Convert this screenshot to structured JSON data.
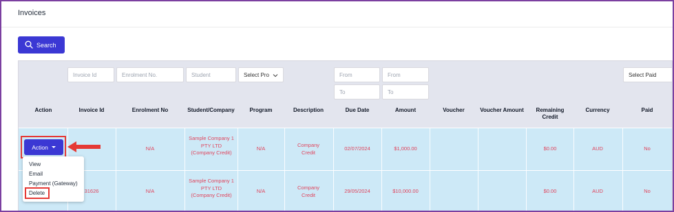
{
  "page": {
    "title": "Invoices"
  },
  "search": {
    "label": "Search"
  },
  "filters": {
    "invoice_id": "Invoice Id",
    "enrolment_no": "Enrolment No.",
    "student": "Student",
    "program": "Select Pro",
    "due_from": "From",
    "due_to": "To",
    "amount_from": "From",
    "amount_to": "To",
    "paid": "Select Paid"
  },
  "columns": [
    "Action",
    "Invoice Id",
    "Enrolment No",
    "Student/Company",
    "Program",
    "Description",
    "Due Date",
    "Amount",
    "Voucher",
    "Voucher Amount",
    "Remaining Credit",
    "Currency",
    "Paid"
  ],
  "rows": [
    {
      "invoice_id": "",
      "enrolment_no": "N/A",
      "student": "Sample Company 1 PTY LTD (Company Credit)",
      "program": "N/A",
      "description": "Company Credit",
      "due_date": "02/07/2024",
      "amount": "$1,000.00",
      "voucher": "",
      "voucher_amount": "",
      "remaining_credit": "$0.00",
      "currency": "AUD",
      "paid": "No"
    },
    {
      "invoice_id": "31626",
      "enrolment_no": "N/A",
      "student": "Sample Company 1 PTY LTD (Company Credit)",
      "program": "N/A",
      "description": "Company Credit",
      "due_date": "29/05/2024",
      "amount": "$10,000.00",
      "voucher": "",
      "voucher_amount": "",
      "remaining_credit": "$0.00",
      "currency": "AUD",
      "paid": "No"
    }
  ],
  "action": {
    "label": "Action"
  },
  "dropdown": {
    "items": [
      "View",
      "Email",
      "Payment (Gateway)",
      "Delete"
    ]
  },
  "colors": {
    "primary": "#3b38d4",
    "row_bg": "#cde9f7",
    "header_bg": "#e3e5ee",
    "cell_text": "#e0445c",
    "highlight": "#e53935",
    "frame": "#7b3fa0"
  }
}
